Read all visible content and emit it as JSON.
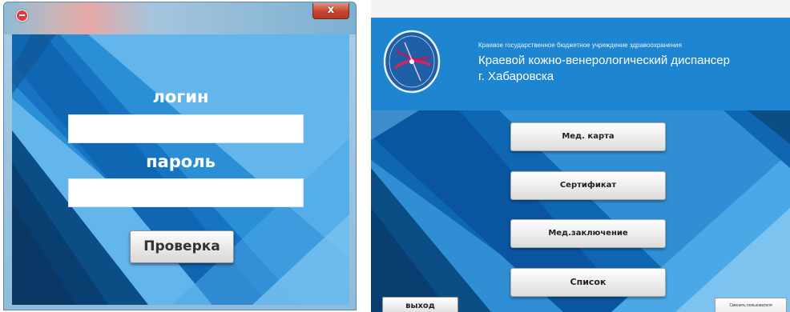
{
  "login_window": {
    "close_glyph": "x",
    "login_label": "логин",
    "login_value": "",
    "password_label": "пароль",
    "password_value": "",
    "check_button": "Проверка",
    "icons": [
      "app-icon",
      "close-icon"
    ]
  },
  "main_window": {
    "org_line1": "Краевое государственное бюджетное учреждение здравоохранения",
    "org_line2": "Краевой кожно-венерологический диспансер",
    "org_line3": "г. Хабаровска",
    "menu": {
      "med_card": "Мед. карта",
      "certificate": "Сертификат",
      "conclusion": "Мед.заключение",
      "list": "Список"
    },
    "exit_button": "выход",
    "change_user_button": "Сменить пользователя",
    "icons": [
      "dispensary-logo-icon"
    ]
  },
  "colors": {
    "background_blue": "#63b6eb",
    "header_blue": "#1e85d0",
    "dark_stripe": "#0b4d85",
    "close_red": "#c7432d"
  }
}
